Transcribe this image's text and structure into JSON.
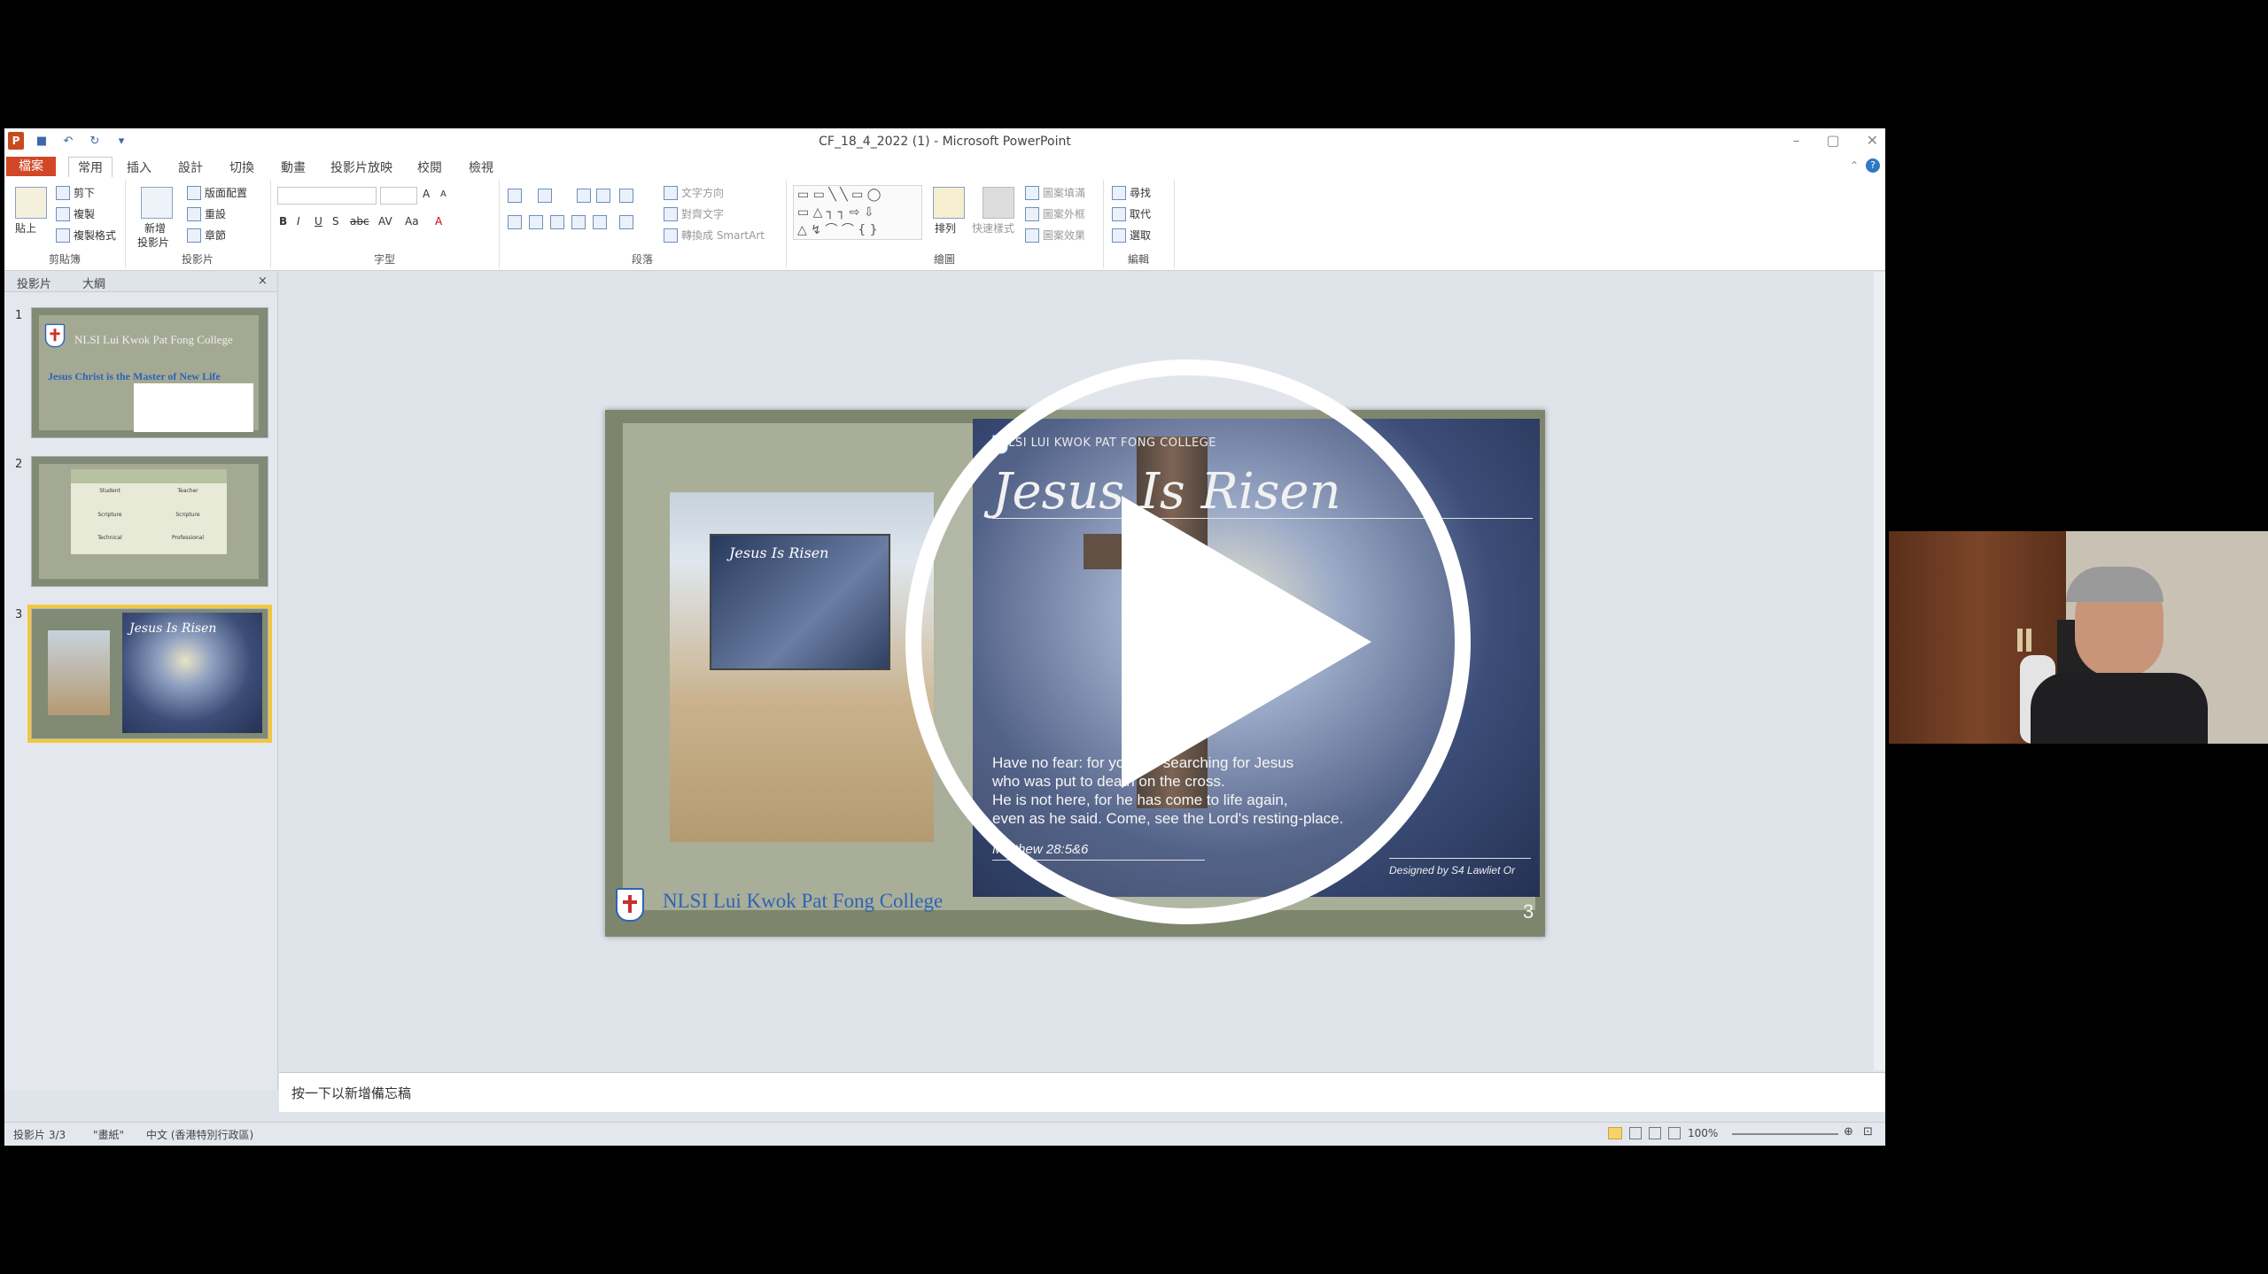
{
  "window": {
    "title": "CF_18_4_2022 (1)  -  Microsoft PowerPoint",
    "app_badge": "P"
  },
  "tabs": [
    "檔案",
    "常用",
    "插入",
    "設計",
    "切換",
    "動畫",
    "投影片放映",
    "校閱",
    "檢視"
  ],
  "ribbon": {
    "clipboard": {
      "paste": "貼上",
      "cut": "剪下",
      "copy": "複製",
      "format_painter": "複製格式",
      "label": "剪貼簿"
    },
    "slides": {
      "new_slide": "新增",
      "new_slide2": "投影片",
      "layout": "版面配置",
      "reset": "重設",
      "section": "章節",
      "label": "投影片"
    },
    "font": {
      "label": "字型",
      "bold": "B",
      "italic": "I",
      "underline": "U",
      "strike": "S",
      "shadow": "abc",
      "spacing": "AV",
      "case": "Aa",
      "color": "A",
      "grow": "A",
      "shrink": "A"
    },
    "paragraph": {
      "label": "段落",
      "text_direction": "文字方向",
      "align_text": "對齊文字",
      "smartart": "轉換成 SmartArt"
    },
    "drawing": {
      "label": "繪圖",
      "arrange": "排列",
      "quick_styles": "快速樣式",
      "fill": "圖案填滿",
      "outline": "圖案外框",
      "effects": "圖案效果"
    },
    "editing": {
      "label": "編輯",
      "find": "尋找",
      "replace": "取代",
      "select": "選取"
    }
  },
  "left_pane": {
    "tab_slides": "投影片",
    "tab_outline": "大綱",
    "close": "×",
    "thumbs": [
      {
        "num": "1",
        "title": "NLSI Lui Kwok Pat Fong College",
        "subtitle": "Jesus Christ is the Master of New Life"
      },
      {
        "num": "2",
        "cells": [
          "Student",
          "Teacher",
          "Scripture",
          "Scripture",
          "Technical",
          "Professional"
        ]
      },
      {
        "num": "3",
        "title": "Jesus Is Risen"
      }
    ]
  },
  "slide": {
    "header": "NLSI LUI KWOK PAT FONG COLLEGE",
    "title": "Jesus Is Risen",
    "verse_lines": [
      "Have no fear: for you are searching for Jesus",
      "who was put to death on the cross.",
      "He is not here, for he has come to life again,",
      "even as he said. Come, see the Lord's resting-place."
    ],
    "reference": "Matthew 28:5&6",
    "credit": "Designed by S4 Lawliet Or",
    "college": "NLSI Lui Kwok Pat Fong College",
    "page_number": "3",
    "banner_title": "Jesus Is Risen"
  },
  "notes_placeholder": "按一下以新增備忘稿",
  "status": {
    "slide_info": "投影片 3/3",
    "theme": "\"畫紙\"",
    "language": "中文 (香港特別行政區)",
    "zoom": "100%"
  },
  "colors": {
    "file_tab": "#d24726",
    "accent": "#2d63b8",
    "selected_thumb": "#f3c63f"
  }
}
